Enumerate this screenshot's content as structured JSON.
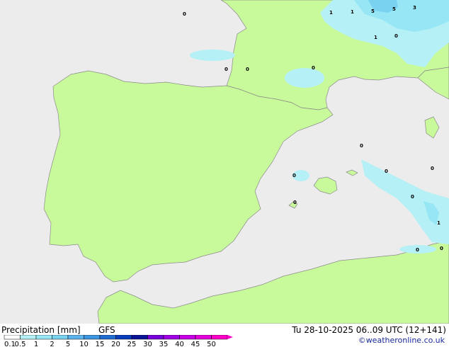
{
  "footer": {
    "title": "Precipitation [mm]",
    "model": "GFS",
    "valid_time": "Tu 28-10-2025 06..09 UTC (12+141)",
    "credit": "©weatheronline.co.uk"
  },
  "colorbar": {
    "ticks": [
      "0.1",
      "0.5",
      "1",
      "2",
      "5",
      "10",
      "15",
      "20",
      "25",
      "30",
      "35",
      "40",
      "45",
      "50"
    ],
    "colors": [
      "#ffffff",
      "#b4f0f5",
      "#96e6f5",
      "#78d2f0",
      "#5ab4eb",
      "#3c96e1",
      "#1e6ed2",
      "#0a3cbe",
      "#0a1496",
      "#7800dc",
      "#a000e6",
      "#c800e6",
      "#e600dc",
      "#ff00c8"
    ]
  },
  "colors": {
    "sea": "#ececec",
    "land": "#c8fa9b",
    "precip_light": "#b4f0f5",
    "precip_medium": "#96e6f5",
    "precip_heavy": "#78d2f0"
  },
  "map": {
    "labels": [
      "0",
      "0",
      "0",
      "0",
      "1",
      "1",
      "5",
      "5",
      "3",
      "1",
      "0",
      "0",
      "0",
      "0",
      "0",
      "0",
      "0",
      "1",
      "0",
      "0"
    ]
  }
}
